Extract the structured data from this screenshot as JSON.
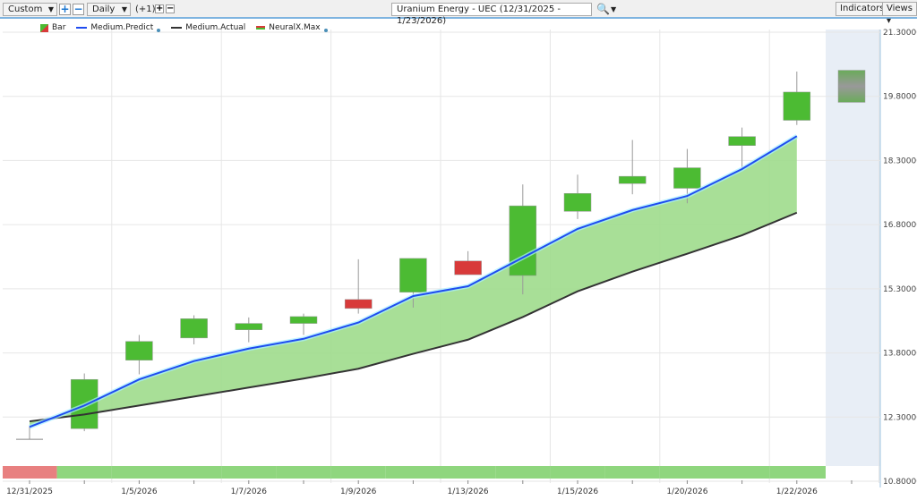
{
  "toolbar": {
    "period_select": "Custom",
    "interval_select": "Daily",
    "offset_label": "(+1)",
    "symbol_title": "Uranium Energy - UEC (12/31/2025 - 1/23/2026)",
    "indicators_label": "Indicators",
    "views_label": "Views"
  },
  "legend": [
    {
      "label": "Bar"
    },
    {
      "label": "Medium.Predict"
    },
    {
      "label": "Medium.Actual"
    },
    {
      "label": "NeuralX.Max"
    }
  ],
  "colors": {
    "up": "#4cbb33",
    "down": "#d83a3a",
    "predict": "#1f4cf0",
    "actual": "#333333",
    "fill": "#9edb8c",
    "forecast_bg": "#e8eef6"
  },
  "chart_data": {
    "type": "candlestick",
    "title": "Uranium Energy - UEC (12/31/2025 - 1/23/2026)",
    "ylim": [
      10.8,
      21.3
    ],
    "y_ticks": [
      "21.30000",
      "19.80000",
      "18.30000",
      "16.80000",
      "15.30000",
      "13.80000",
      "12.30000",
      "10.80000"
    ],
    "y_tick_values": [
      21.3,
      19.8,
      18.3,
      16.8,
      15.3,
      13.8,
      12.3,
      10.8
    ],
    "dates": [
      "12/31/2025",
      "1/2/2026",
      "1/5/2026",
      "1/6/2026",
      "1/7/2026",
      "1/8/2026",
      "1/9/2026",
      "1/12/2026",
      "1/13/2026",
      "1/14/2026",
      "1/15/2026",
      "1/16/2026",
      "1/20/2026",
      "1/21/2026",
      "1/22/2026",
      "1/23/2026"
    ],
    "x_labels": [
      "12/31/2025",
      "1/5/2026",
      "1/7/2026",
      "1/9/2026",
      "1/13/2026",
      "1/15/2026",
      "1/20/2026",
      "1/22/2026"
    ],
    "x_label_indices": [
      0,
      2,
      4,
      6,
      8,
      10,
      12,
      14
    ],
    "ohlc": [
      [
        11.78,
        12.08,
        11.78,
        11.78
      ],
      [
        12.03,
        13.32,
        11.97,
        13.18
      ],
      [
        13.63,
        14.22,
        13.3,
        14.07
      ],
      [
        14.15,
        14.68,
        14.0,
        14.6
      ],
      [
        14.34,
        14.63,
        14.05,
        14.49
      ],
      [
        14.49,
        14.72,
        14.22,
        14.65
      ],
      [
        15.05,
        15.99,
        14.72,
        14.84
      ],
      [
        15.22,
        16.01,
        14.86,
        16.01
      ],
      [
        15.95,
        16.18,
        15.63,
        15.63
      ],
      [
        15.61,
        17.74,
        15.17,
        17.24
      ],
      [
        17.11,
        17.97,
        16.93,
        17.53
      ],
      [
        17.76,
        18.78,
        17.51,
        17.93
      ],
      [
        17.65,
        18.57,
        17.3,
        18.13
      ],
      [
        18.65,
        19.07,
        18.09,
        18.86
      ],
      [
        19.24,
        20.38,
        19.13,
        19.9
      ]
    ],
    "forecast": {
      "date": "1/23/2026",
      "low": 19.66,
      "high": 20.41
    },
    "series": [
      {
        "name": "Medium.Predict",
        "values": [
          12.07,
          12.57,
          13.18,
          13.61,
          13.9,
          14.13,
          14.51,
          15.13,
          15.36,
          16.03,
          16.7,
          17.14,
          17.47,
          18.1,
          18.87
        ]
      },
      {
        "name": "Medium.Actual",
        "values": [
          12.2,
          12.36,
          12.57,
          12.78,
          12.99,
          13.2,
          13.43,
          13.78,
          14.11,
          14.64,
          15.24,
          15.7,
          16.12,
          16.55,
          17.08
        ]
      }
    ],
    "signal": [
      "down",
      "up",
      "up",
      "up",
      "up",
      "up",
      "up",
      "up",
      "up",
      "up",
      "up",
      "up",
      "up",
      "up",
      "up"
    ]
  }
}
